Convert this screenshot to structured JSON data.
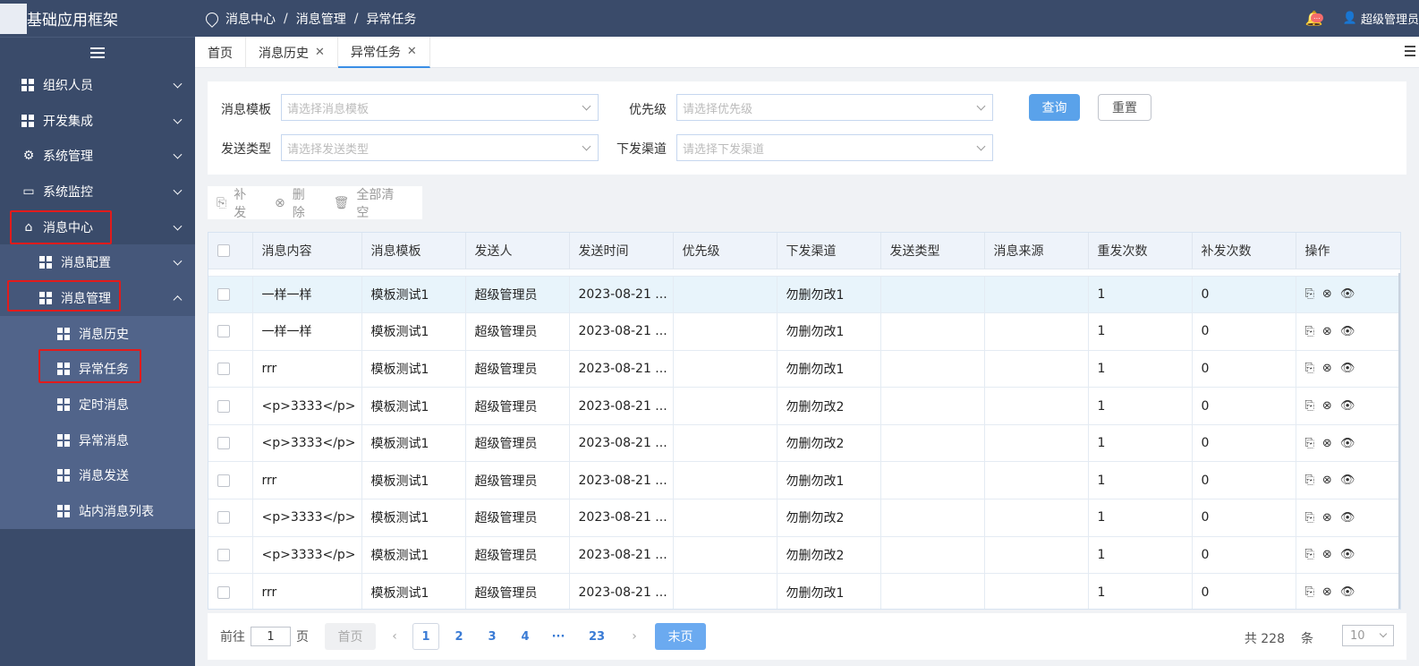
{
  "app": {
    "title": "基础应用框架"
  },
  "sidebar": {
    "items": [
      {
        "label": "组织人员",
        "icon": "grid-icon"
      },
      {
        "label": "开发集成",
        "icon": "grid-icon"
      },
      {
        "label": "系统管理",
        "icon": "gear-icon"
      },
      {
        "label": "系统监控",
        "icon": "monitor-icon"
      },
      {
        "label": "消息中心",
        "icon": "home-icon"
      }
    ],
    "sub_items": [
      {
        "label": "消息配置"
      },
      {
        "label": "消息管理"
      }
    ],
    "sub_sub_items": [
      {
        "label": "消息历史"
      },
      {
        "label": "异常任务"
      },
      {
        "label": "定时消息"
      },
      {
        "label": "异常消息"
      },
      {
        "label": "消息发送"
      },
      {
        "label": "站内消息列表"
      }
    ]
  },
  "header": {
    "breadcrumb": [
      "消息中心",
      "消息管理",
      "异常任务"
    ],
    "badge": "...",
    "user": "超级管理员"
  },
  "tabs": [
    {
      "label": "首页"
    },
    {
      "label": "消息历史"
    },
    {
      "label": "异常任务"
    }
  ],
  "filters": {
    "template_label": "消息模板",
    "template_placeholder": "请选择消息模板",
    "priority_label": "优先级",
    "priority_placeholder": "请选择优先级",
    "send_type_label": "发送类型",
    "send_type_placeholder": "请选择发送类型",
    "channel_label": "下发渠道",
    "channel_placeholder": "请选择下发渠道",
    "query_button": "查询",
    "reset_button": "重置"
  },
  "toolbar": {
    "resend": "补发",
    "delete": "删除",
    "clear_all": "全部清空"
  },
  "table": {
    "columns": [
      "消息内容",
      "消息模板",
      "发送人",
      "发送时间",
      "优先级",
      "下发渠道",
      "发送类型",
      "消息来源",
      "重发次数",
      "补发次数",
      "操作"
    ],
    "rows": [
      [
        "一样一样",
        "模板测试1",
        "超级管理员",
        "2023-08-21 ...",
        "",
        "勿删勿改1",
        "",
        "",
        "1",
        "0"
      ],
      [
        "一样一样",
        "模板测试1",
        "超级管理员",
        "2023-08-21 ...",
        "",
        "勿删勿改1",
        "",
        "",
        "1",
        "0"
      ],
      [
        "rrr",
        "模板测试1",
        "超级管理员",
        "2023-08-21 ...",
        "",
        "勿删勿改1",
        "",
        "",
        "1",
        "0"
      ],
      [
        "<p>3333</p>",
        "模板测试1",
        "超级管理员",
        "2023-08-21 ...",
        "",
        "勿删勿改2",
        "",
        "",
        "1",
        "0"
      ],
      [
        "<p>3333</p>",
        "模板测试1",
        "超级管理员",
        "2023-08-21 ...",
        "",
        "勿删勿改2",
        "",
        "",
        "1",
        "0"
      ],
      [
        "rrr",
        "模板测试1",
        "超级管理员",
        "2023-08-21 ...",
        "",
        "勿删勿改1",
        "",
        "",
        "1",
        "0"
      ],
      [
        "<p>3333</p>",
        "模板测试1",
        "超级管理员",
        "2023-08-21 ...",
        "",
        "勿删勿改2",
        "",
        "",
        "1",
        "0"
      ],
      [
        "<p>3333</p>",
        "模板测试1",
        "超级管理员",
        "2023-08-21 ...",
        "",
        "勿删勿改2",
        "",
        "",
        "1",
        "0"
      ],
      [
        "rrr",
        "模板测试1",
        "超级管理员",
        "2023-08-21 ...",
        "",
        "勿删勿改1",
        "",
        "",
        "1",
        "0"
      ]
    ]
  },
  "pagination": {
    "goto_prefix": "前往",
    "goto_value": "1",
    "goto_suffix": "页",
    "first": "首页",
    "pages": [
      "1",
      "2",
      "3",
      "4",
      "···",
      "23"
    ],
    "last": "末页",
    "total_prefix": "共 228",
    "total_suffix": "条",
    "page_size": "10"
  },
  "colors": {
    "sidebar": "#3a4b6a",
    "accent": "#3a8ee6",
    "highlight_box": "#e21b1b"
  }
}
